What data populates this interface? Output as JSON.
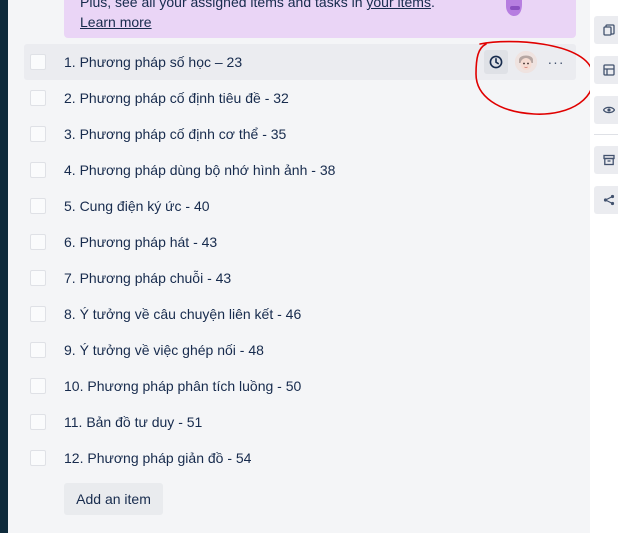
{
  "banner": {
    "text_prefix": "Plus, see all your assigned items and tasks in ",
    "link_text": "your items",
    "text_suffix": ".",
    "learn_more": "Learn more"
  },
  "checklist": {
    "items": [
      {
        "label": "1. Phương pháp số học – 23"
      },
      {
        "label": "2. Phương pháp cố định tiêu đề - 32"
      },
      {
        "label": "3. Phương pháp cố định cơ thể - 35"
      },
      {
        "label": "4. Phương pháp dùng bộ nhớ hình ảnh - 38"
      },
      {
        "label": "5. Cung điện ký ức - 40"
      },
      {
        "label": "6. Phương pháp hát - 43"
      },
      {
        "label": "7. Phương pháp chuỗi - 43"
      },
      {
        "label": "8. Ý tưởng về câu chuyện liên kết - 46"
      },
      {
        "label": "9. Ý tưởng về việc ghép nối - 48"
      },
      {
        "label": "10. Phương pháp phân tích luồng - 50"
      },
      {
        "label": "11. Bản đồ tư duy - 51"
      },
      {
        "label": "12. Phương pháp giản đồ - 54"
      }
    ],
    "add_item_label": "Add an item",
    "item_actions": {
      "due_icon": "clock-icon",
      "member_icon": "avatar",
      "more_label": "···"
    }
  },
  "sidebar_icons": [
    "copy-icon",
    "template-icon",
    "watch-icon",
    "archive-icon",
    "share-icon"
  ],
  "colors": {
    "banner_bg": "#ead5f6",
    "annotation_red": "#e00000",
    "app_rail": "#0e2a3b"
  }
}
